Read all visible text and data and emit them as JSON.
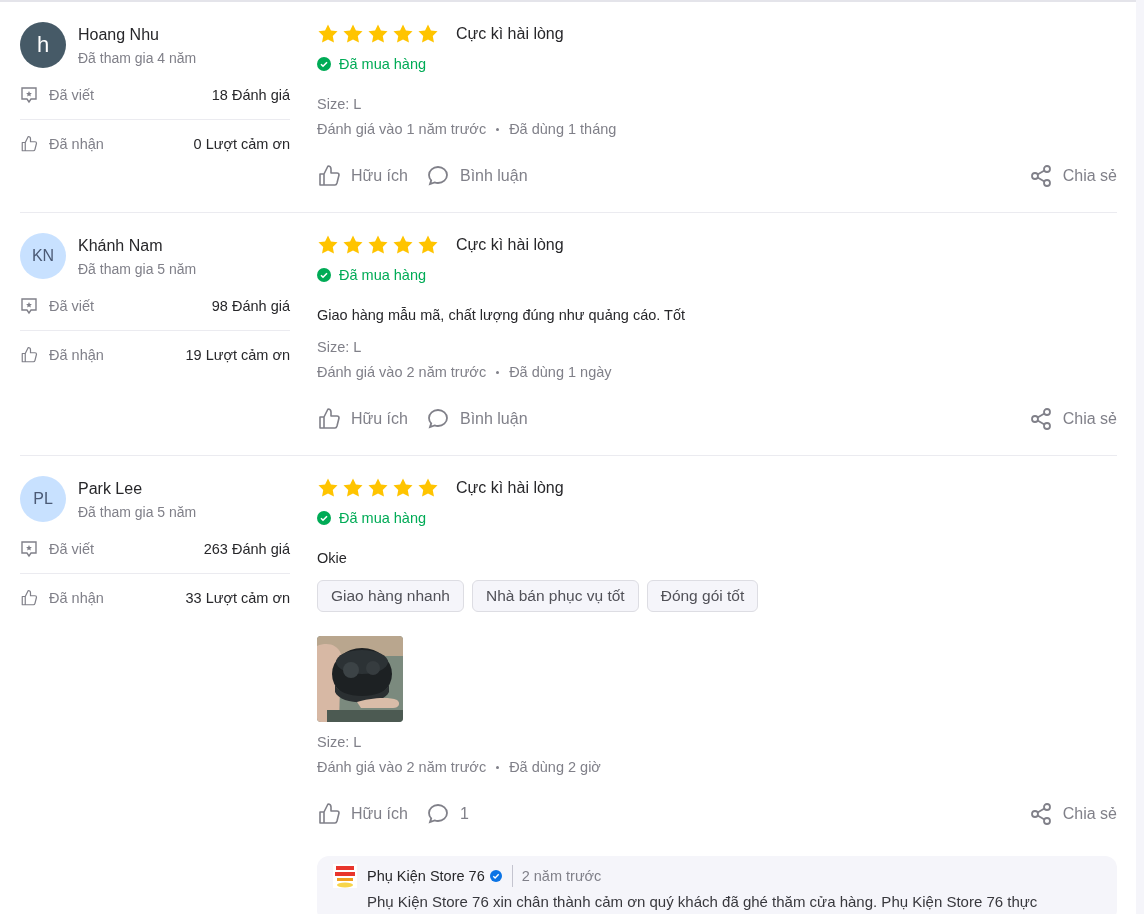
{
  "reviews": [
    {
      "avatar": {
        "initials": "h",
        "color": "#465a67"
      },
      "name": "Hoang Nhu",
      "joined": "Đã tham gia 4 năm",
      "written_label": "Đã viết",
      "written_value": "18 Đánh giá",
      "received_label": "Đã nhận",
      "received_value": "0 Lượt cảm ơn",
      "stars": 5,
      "rating_label": "Cực kì hài lòng",
      "purchased": "Đã mua hàng",
      "size": "Size: L",
      "reviewed_at": "Đánh giá vào 1 năm trước",
      "used_for": "Đã dùng 1 tháng",
      "helpful": "Hữu ích",
      "comment": "Bình luận",
      "share": "Chia sẻ"
    },
    {
      "avatar": {
        "initials": "KN",
        "color": "#c8e1ff"
      },
      "name": "Khánh Nam",
      "joined": "Đã tham gia 5 năm",
      "written_label": "Đã viết",
      "written_value": "98 Đánh giá",
      "received_label": "Đã nhận",
      "received_value": "19 Lượt cảm ơn",
      "stars": 5,
      "rating_label": "Cực kì hài lòng",
      "purchased": "Đã mua hàng",
      "text": "Giao hàng mẫu mã, chất lượng đúng như quảng cáo. Tốt",
      "size": "Size: L",
      "reviewed_at": "Đánh giá vào 2 năm trước",
      "used_for": "Đã dùng 1 ngày",
      "helpful": "Hữu ích",
      "comment": "Bình luận",
      "share": "Chia sẻ"
    },
    {
      "avatar": {
        "initials": "PL",
        "color": "#c8e1ff"
      },
      "name": "Park Lee",
      "joined": "Đã tham gia 5 năm",
      "written_label": "Đã viết",
      "written_value": "263 Đánh giá",
      "received_label": "Đã nhận",
      "received_value": "33 Lượt cảm ơn",
      "stars": 5,
      "rating_label": "Cực kì hài lòng",
      "purchased": "Đã mua hàng",
      "text": "Okie",
      "tags": [
        "Giao hàng nhanh",
        "Nhà bán phục vụ tốt",
        "Đóng gói tốt"
      ],
      "photos": [
        {
          "kind": "picture"
        }
      ],
      "size": "Size: L",
      "reviewed_at": "Đánh giá vào 2 năm trước",
      "used_for": "Đã dùng 2 giờ",
      "helpful": "Hữu ích",
      "comment": "1",
      "share": "Chia sẻ",
      "reply": {
        "seller": "Phụ Kiện Store 76",
        "verified": true,
        "time": "2 năm trước",
        "text": "Phụ Kiện Store 76 xin chân thành cảm ơn quý khách đã ghé thăm cửa hàng. Phụ Kiện Store 76 thực"
      }
    }
  ]
}
